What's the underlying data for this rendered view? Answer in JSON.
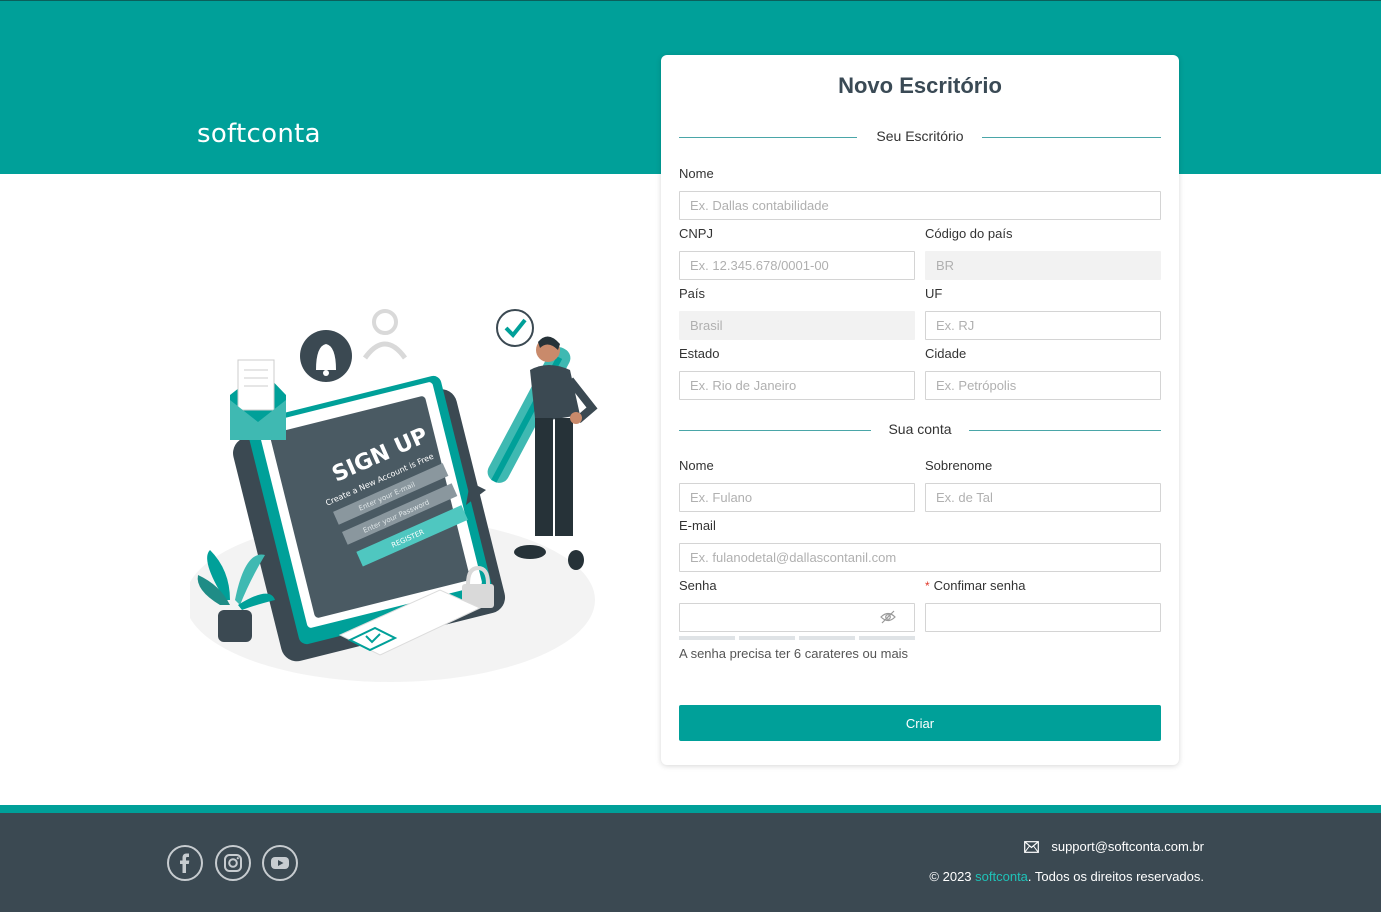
{
  "brand": {
    "logo_text": "softconta"
  },
  "card": {
    "title": "Novo Escritório",
    "section_office": "Seu Escritório",
    "section_account": "Sua conta",
    "office_fields": {
      "nome": {
        "label": "Nome",
        "placeholder": "Ex. Dallas contabilidade",
        "value": ""
      },
      "cnpj": {
        "label": "CNPJ",
        "placeholder": "Ex. 12.345.678/0001-00",
        "value": ""
      },
      "codigo_pais": {
        "label": "Código do país",
        "value": "BR"
      },
      "pais": {
        "label": "País",
        "value": "Brasil"
      },
      "uf": {
        "label": "UF",
        "placeholder": "Ex. RJ",
        "value": ""
      },
      "estado": {
        "label": "Estado",
        "placeholder": "Ex. Rio de Janeiro",
        "value": ""
      },
      "cidade": {
        "label": "Cidade",
        "placeholder": "Ex. Petrópolis",
        "value": ""
      }
    },
    "account_fields": {
      "nome": {
        "label": "Nome",
        "placeholder": "Ex. Fulano",
        "value": ""
      },
      "sobrenome": {
        "label": "Sobrenome",
        "placeholder": "Ex. de Tal",
        "value": ""
      },
      "email": {
        "label": "E-mail",
        "placeholder": "Ex. fulanodetal@dallascontanil.com",
        "value": ""
      },
      "senha": {
        "label": "Senha",
        "value": ""
      },
      "confirmar_senha": {
        "label": "Confimar senha",
        "required_mark": "*",
        "value": ""
      }
    },
    "password_hint": "A senha precisa ter 6 carateres ou mais",
    "submit_label": "Criar"
  },
  "illustration": {
    "title": "SIGN UP",
    "subtitle": "Create a New Account is Free",
    "email_field": "Enter your E-mail",
    "password_field": "Enter your Password",
    "button": "REGISTER"
  },
  "footer": {
    "social_icons": [
      "facebook-icon",
      "instagram-icon",
      "youtube-icon"
    ],
    "support_email": "support@softconta.com.br",
    "copyright_prefix": "© 2023 ",
    "copyright_brand": "softconta",
    "copyright_suffix": ". Todos os direitos reservados."
  },
  "colors": {
    "primary": "#00a099",
    "footer_bg": "#3b4952",
    "dark_text": "#3a4a55"
  }
}
